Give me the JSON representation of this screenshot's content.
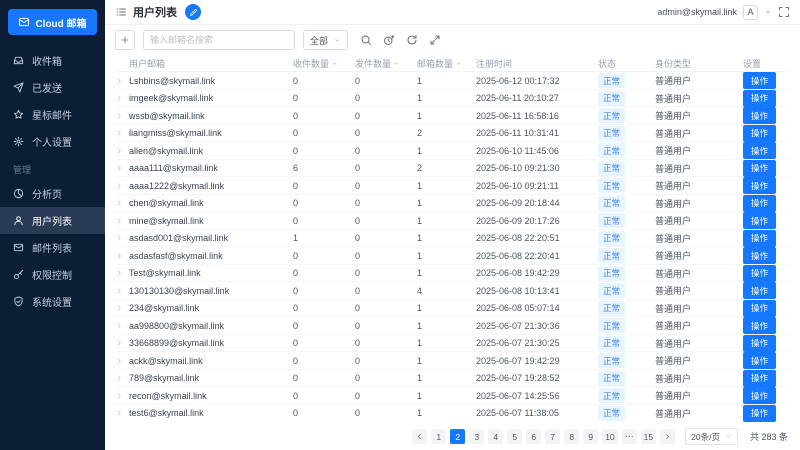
{
  "sidebar": {
    "brand_label": "Cloud 邮箱",
    "section_label": "管理",
    "main_items": [
      {
        "label": "收件箱",
        "icon": "inbox-icon"
      },
      {
        "label": "已发送",
        "icon": "send-icon"
      },
      {
        "label": "星标邮件",
        "icon": "star-icon"
      },
      {
        "label": "个人设置",
        "icon": "gear-icon"
      }
    ],
    "admin_items": [
      {
        "label": "分析页",
        "icon": "pie-chart-icon"
      },
      {
        "label": "用户列表",
        "icon": "user-icon",
        "active": true
      },
      {
        "label": "邮件列表",
        "icon": "mail-icon"
      },
      {
        "label": "权限控制",
        "icon": "key-icon"
      },
      {
        "label": "系统设置",
        "icon": "shield-icon"
      }
    ]
  },
  "header": {
    "title": "用户列表",
    "account": "admin@skymail.link",
    "avatar_letter": "A"
  },
  "toolbar": {
    "search_placeholder": "输入邮箱名搜索",
    "filter_value": "全部"
  },
  "table": {
    "columns": [
      {
        "label": "用户邮箱"
      },
      {
        "label": "收件数量",
        "sortable": true
      },
      {
        "label": "发件数量",
        "sortable": true
      },
      {
        "label": "邮箱数量",
        "sortable": true
      },
      {
        "label": "注册时间"
      },
      {
        "label": "状态"
      },
      {
        "label": "身份类型"
      },
      {
        "label": "设置"
      }
    ],
    "status_label": "正常",
    "role_label": "普通用户",
    "action_label": "操作",
    "rows": [
      {
        "email": "Lshbins@skymail.link",
        "recv": "0",
        "sent": "0",
        "boxes": "1",
        "time": "2025-06-12 00:17:32"
      },
      {
        "email": "imgeek@skymail.link",
        "recv": "0",
        "sent": "0",
        "boxes": "1",
        "time": "2025-06-11 20:10:27"
      },
      {
        "email": "wssb@skymail.link",
        "recv": "0",
        "sent": "0",
        "boxes": "1",
        "time": "2025-06-11 16:58:16"
      },
      {
        "email": "liangmiss@skymail.link",
        "recv": "0",
        "sent": "0",
        "boxes": "2",
        "time": "2025-06-11 10:31:41"
      },
      {
        "email": "allen@skymail.link",
        "recv": "0",
        "sent": "0",
        "boxes": "1",
        "time": "2025-06-10 11:45:06"
      },
      {
        "email": "aaaa111@skymail.link",
        "recv": "6",
        "sent": "0",
        "boxes": "2",
        "time": "2025-06-10 09:21:30"
      },
      {
        "email": "aaaa1222@skymail.link",
        "recv": "0",
        "sent": "0",
        "boxes": "1",
        "time": "2025-06-10 09:21:11"
      },
      {
        "email": "chen@skymail.link",
        "recv": "0",
        "sent": "0",
        "boxes": "1",
        "time": "2025-06-09 20:18:44"
      },
      {
        "email": "mine@skymail.link",
        "recv": "0",
        "sent": "0",
        "boxes": "1",
        "time": "2025-06-09 20:17:26"
      },
      {
        "email": "asdasd001@skymail.link",
        "recv": "1",
        "sent": "0",
        "boxes": "1",
        "time": "2025-06-08 22:20:51"
      },
      {
        "email": "asdasfasf@skymail.link",
        "recv": "0",
        "sent": "0",
        "boxes": "1",
        "time": "2025-06-08 22:20:41"
      },
      {
        "email": "Test@skymail.link",
        "recv": "0",
        "sent": "0",
        "boxes": "1",
        "time": "2025-06-08 19:42:29"
      },
      {
        "email": "130130130@skymail.link",
        "recv": "0",
        "sent": "0",
        "boxes": "4",
        "time": "2025-06-08 10:13:41"
      },
      {
        "email": "234@skymail.link",
        "recv": "0",
        "sent": "0",
        "boxes": "1",
        "time": "2025-06-08 05:07:14"
      },
      {
        "email": "aa998800@skymail.link",
        "recv": "0",
        "sent": "0",
        "boxes": "1",
        "time": "2025-06-07 21:30:36"
      },
      {
        "email": "33668899@skymail.link",
        "recv": "0",
        "sent": "0",
        "boxes": "1",
        "time": "2025-06-07 21:30:25"
      },
      {
        "email": "ackk@skymail.link",
        "recv": "0",
        "sent": "0",
        "boxes": "1",
        "time": "2025-06-07 19:42:29"
      },
      {
        "email": "789@skymail.link",
        "recv": "0",
        "sent": "0",
        "boxes": "1",
        "time": "2025-06-07 19:28:52"
      },
      {
        "email": "recon@skymail.link",
        "recv": "0",
        "sent": "0",
        "boxes": "1",
        "time": "2025-06-07 14:25:56"
      },
      {
        "email": "test6@skymail.link",
        "recv": "0",
        "sent": "0",
        "boxes": "1",
        "time": "2025-06-07 11:38:05"
      }
    ]
  },
  "pagination": {
    "pages": [
      {
        "label": "1"
      },
      {
        "label": "2",
        "active": true
      },
      {
        "label": "3"
      },
      {
        "label": "4"
      },
      {
        "label": "5"
      },
      {
        "label": "6"
      },
      {
        "label": "7"
      },
      {
        "label": "8"
      },
      {
        "label": "9"
      },
      {
        "label": "10"
      },
      {
        "label": "⋯"
      },
      {
        "label": "15"
      }
    ],
    "page_size": "20条/页",
    "total": "共 283 条"
  },
  "colors": {
    "accent": "#1677ff",
    "sidebar_bg": "#0c1d36",
    "badge_bg": "#e8f4ff",
    "badge_text": "#3d8af0"
  }
}
